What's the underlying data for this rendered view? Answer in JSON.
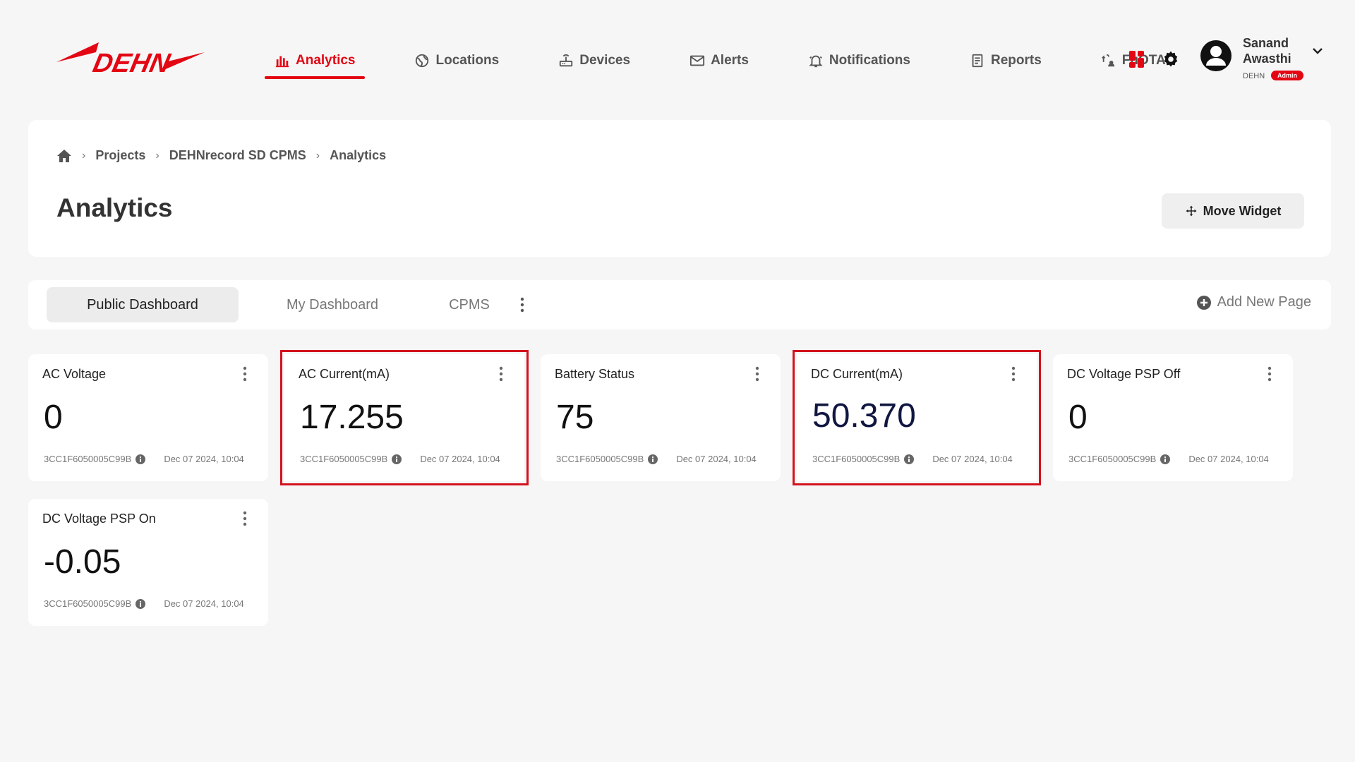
{
  "brand": {
    "logo_text": "DEHN",
    "accent": "#e30613"
  },
  "nav": {
    "items": [
      {
        "label": "Analytics",
        "icon": "bar-chart-icon",
        "active": true
      },
      {
        "label": "Locations",
        "icon": "globe-icon"
      },
      {
        "label": "Devices",
        "icon": "router-icon"
      },
      {
        "label": "Alerts",
        "icon": "mail-icon"
      },
      {
        "label": "Notifications",
        "icon": "bell-icon"
      },
      {
        "label": "Reports",
        "icon": "document-icon"
      },
      {
        "label": "FuOTA",
        "icon": "fuota-icon"
      }
    ]
  },
  "user": {
    "first_name": "Sanand",
    "last_name": "Awasthi",
    "org": "DEHN",
    "role": "Admin"
  },
  "breadcrumb": {
    "home_icon": "home-icon",
    "items": [
      "Projects",
      "DEHNrecord SD CPMS",
      "Analytics"
    ]
  },
  "page": {
    "title": "Analytics",
    "move_widget_label": "Move Widget"
  },
  "tabs": {
    "items": [
      {
        "label": "Public Dashboard",
        "active": true
      },
      {
        "label": "My Dashboard"
      },
      {
        "label": "CPMS"
      }
    ],
    "add_page_label": "Add New Page"
  },
  "widgets": [
    {
      "title": "AC Voltage",
      "value": "0",
      "device": "3CC1F6050005C99B",
      "date": "Dec 07 2024, 10:04",
      "highlighted": false
    },
    {
      "title": "AC Current(mA)",
      "value": "17.255",
      "device": "3CC1F6050005C99B",
      "date": "Dec 07 2024, 10:04",
      "highlighted": true
    },
    {
      "title": "Battery Status",
      "value": "75",
      "device": "3CC1F6050005C99B",
      "date": "Dec 07 2024, 10:04",
      "highlighted": false
    },
    {
      "title": "DC Current(mA)",
      "value": "50.370",
      "device": "3CC1F6050005C99B",
      "date": "Dec 07 2024, 10:04",
      "highlighted": true
    },
    {
      "title": "DC Voltage PSP Off",
      "value": "0",
      "device": "3CC1F6050005C99B",
      "date": "Dec 07 2024, 10:04",
      "highlighted": false
    },
    {
      "title": "DC Voltage PSP On",
      "value": "-0.05",
      "device": "3CC1F6050005C99B",
      "date": "Dec 07 2024, 10:04",
      "highlighted": false
    }
  ]
}
